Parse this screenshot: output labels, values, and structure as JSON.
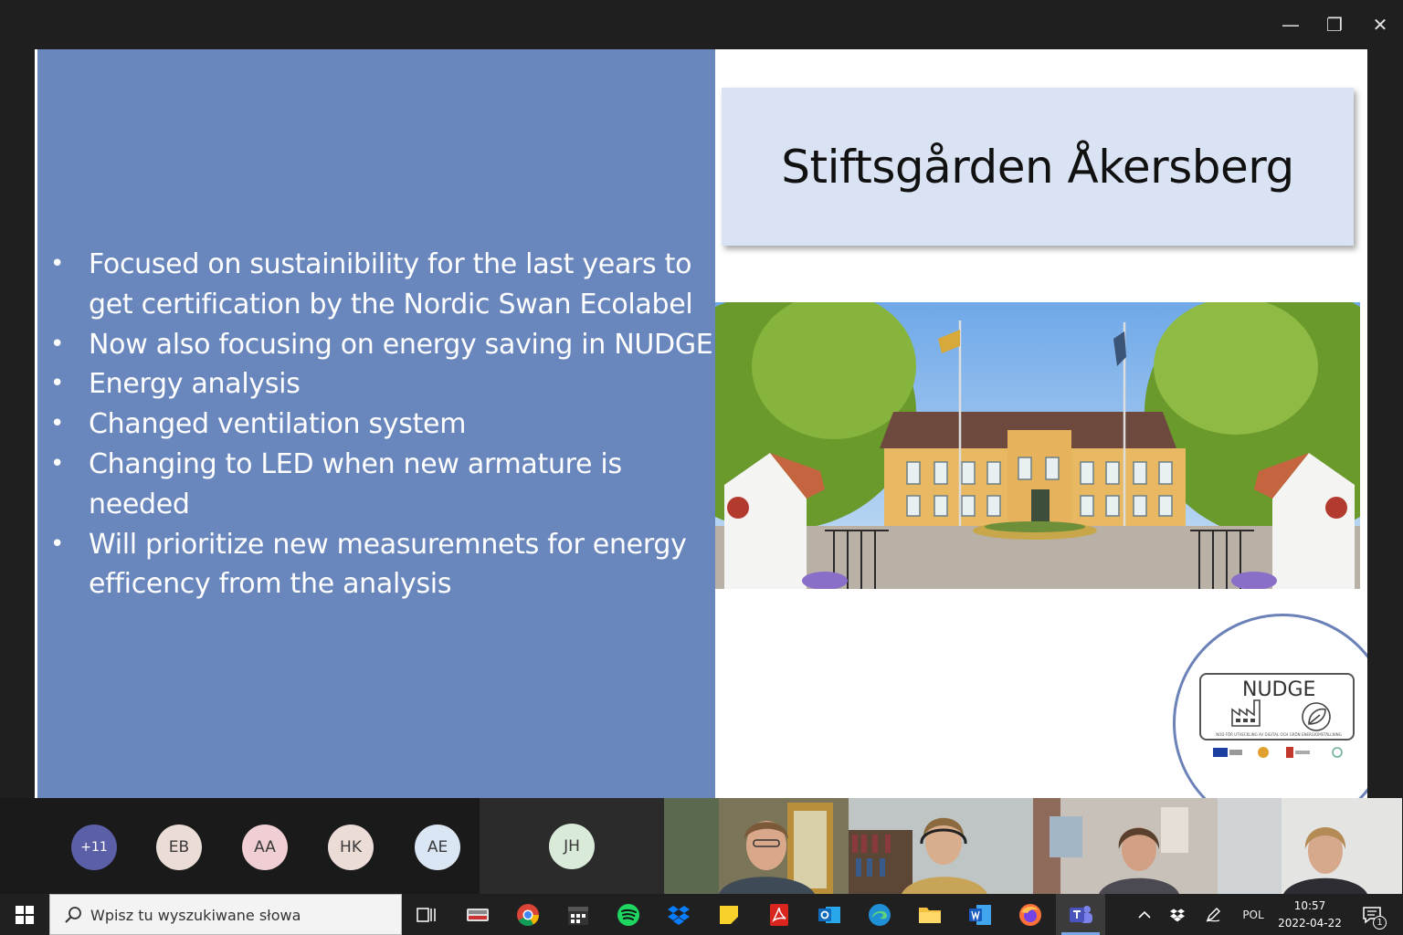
{
  "window": {
    "minimize_icon": "minimize-icon",
    "maximize_icon": "restore-icon",
    "close_icon": "close-icon",
    "min_glyph": "—",
    "max_glyph": "❐",
    "close_glyph": "✕"
  },
  "slide": {
    "title": "Stiftsgården Åkersberg",
    "bullets": [
      "Focused on sustainibility for the last years to get certification by the Nordic Swan Ecolabel",
      "Now also focusing on energy saving in NUDGE",
      "Energy analysis",
      "Changed ventilation system",
      "Changing to LED when new armature is needed",
      "Will prioritize new measuremnets for energy efficency from the analysis"
    ],
    "logo": {
      "title": "NUDGE",
      "tagline": "NOD FÖR UTVECKLING AV DIGITAL OCH GRÖN ENERGIOMSTÄLLNING"
    },
    "colors": {
      "left_panel": "#6a87bd",
      "title_box": "#dae3f3",
      "logo_ring": "#6b82b8"
    }
  },
  "participants": {
    "overflow_count": "+11",
    "avatars": [
      "EB",
      "AA",
      "HK",
      "AE"
    ],
    "tile_initials": "JH",
    "video_count": 4
  },
  "taskbar": {
    "search_placeholder": "Wpisz tu wyszukiwane słowa",
    "apps": [
      "task-view",
      "drive-app",
      "chrome",
      "calendar",
      "spotify",
      "dropbox",
      "sticky-notes",
      "acrobat",
      "outlook",
      "edge",
      "file-explorer",
      "word",
      "firefox",
      "teams"
    ],
    "language": "POL",
    "time": "10:57",
    "date": "2022-04-22",
    "notification_count": "1"
  }
}
